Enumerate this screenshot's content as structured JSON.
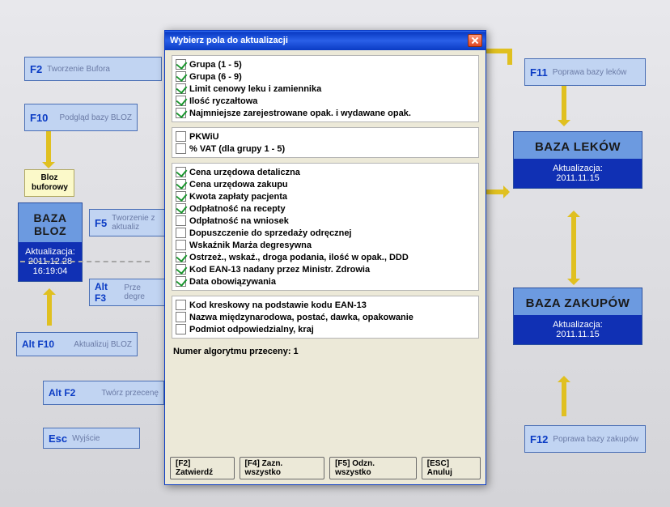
{
  "flow": {
    "f2": {
      "key": "F2",
      "desc": "Tworzenie Bufora"
    },
    "f10": {
      "key": "F10",
      "desc": "Podgląd bazy BLOZ"
    },
    "bloz_buf": "Bloz buforowy",
    "baza_bloz": {
      "title": "BAZA BLOZ",
      "sub1": "Aktualizacja:",
      "sub2": "2011.12.28 16:19:04"
    },
    "f5": {
      "key": "F5",
      "desc": "Tworzenie z aktualiz"
    },
    "altf3": {
      "key": "Alt F3",
      "desc": "Prze degre"
    },
    "altf10": {
      "key": "Alt F10",
      "desc": "Aktualizuj BLOZ"
    },
    "altf2": {
      "key": "Alt F2",
      "desc": "Twórz przecenę"
    },
    "esc": {
      "key": "Esc",
      "desc": "Wyjście"
    },
    "f11": {
      "key": "F11",
      "desc": "Poprawa bazy leków"
    },
    "f12": {
      "key": "F12",
      "desc": "Poprawa bazy zakupów"
    },
    "baza_lekow": {
      "title": "BAZA LEKÓW",
      "sub1": "Aktualizacja:",
      "sub2": "2011.11.15"
    },
    "baza_zakupow": {
      "title": "BAZA ZAKUPÓW",
      "sub1": "Aktualizacja:",
      "sub2": "2011.11.15"
    }
  },
  "dialog": {
    "title": "Wybierz pola do aktualizacji",
    "groups": [
      [
        {
          "c": true,
          "t": "Grupa (1 - 5)"
        },
        {
          "c": true,
          "t": "Grupa (6 - 9)"
        },
        {
          "c": true,
          "t": "Limit cenowy leku i zamiennika"
        },
        {
          "c": true,
          "t": "Ilość ryczałtowa"
        },
        {
          "c": true,
          "t": "Najmniejsze zarejestrowane opak. i wydawane opak."
        }
      ],
      [
        {
          "c": false,
          "t": "PKWiU"
        },
        {
          "c": false,
          "t": "% VAT (dla grupy 1 - 5)"
        }
      ],
      [
        {
          "c": true,
          "t": "Cena urzędowa detaliczna"
        },
        {
          "c": true,
          "t": "Cena urzędowa zakupu"
        },
        {
          "c": true,
          "t": "Kwota zapłaty pacjenta"
        },
        {
          "c": true,
          "t": "Odpłatność na recepty"
        },
        {
          "c": false,
          "t": "Odpłatność na wniosek"
        },
        {
          "c": false,
          "t": "Dopuszczenie do sprzedaży odręcznej"
        },
        {
          "c": false,
          "t": "Wskaźnik Marża degresywna"
        },
        {
          "c": true,
          "t": "Ostrzeż., wskaź., droga podania, ilość w opak., DDD"
        },
        {
          "c": true,
          "t": "Kod EAN-13 nadany przez Ministr. Zdrowia"
        },
        {
          "c": true,
          "t": "Data obowiązywania"
        }
      ],
      [
        {
          "c": false,
          "t": "Kod kreskowy na podstawie kodu EAN-13"
        },
        {
          "c": false,
          "t": "Nazwa międzynarodowa, postać, dawka, opakowanie"
        },
        {
          "c": false,
          "t": "Podmiot odpowiedzialny, kraj"
        }
      ]
    ],
    "algo": "Numer algorytmu przeceny: 1",
    "buttons": {
      "f2": "[F2] Zatwierdź",
      "f4": "[F4] Zazn. wszystko",
      "f5": "[F5] Odzn. wszystko",
      "esc": "[ESC] Anuluj"
    }
  }
}
